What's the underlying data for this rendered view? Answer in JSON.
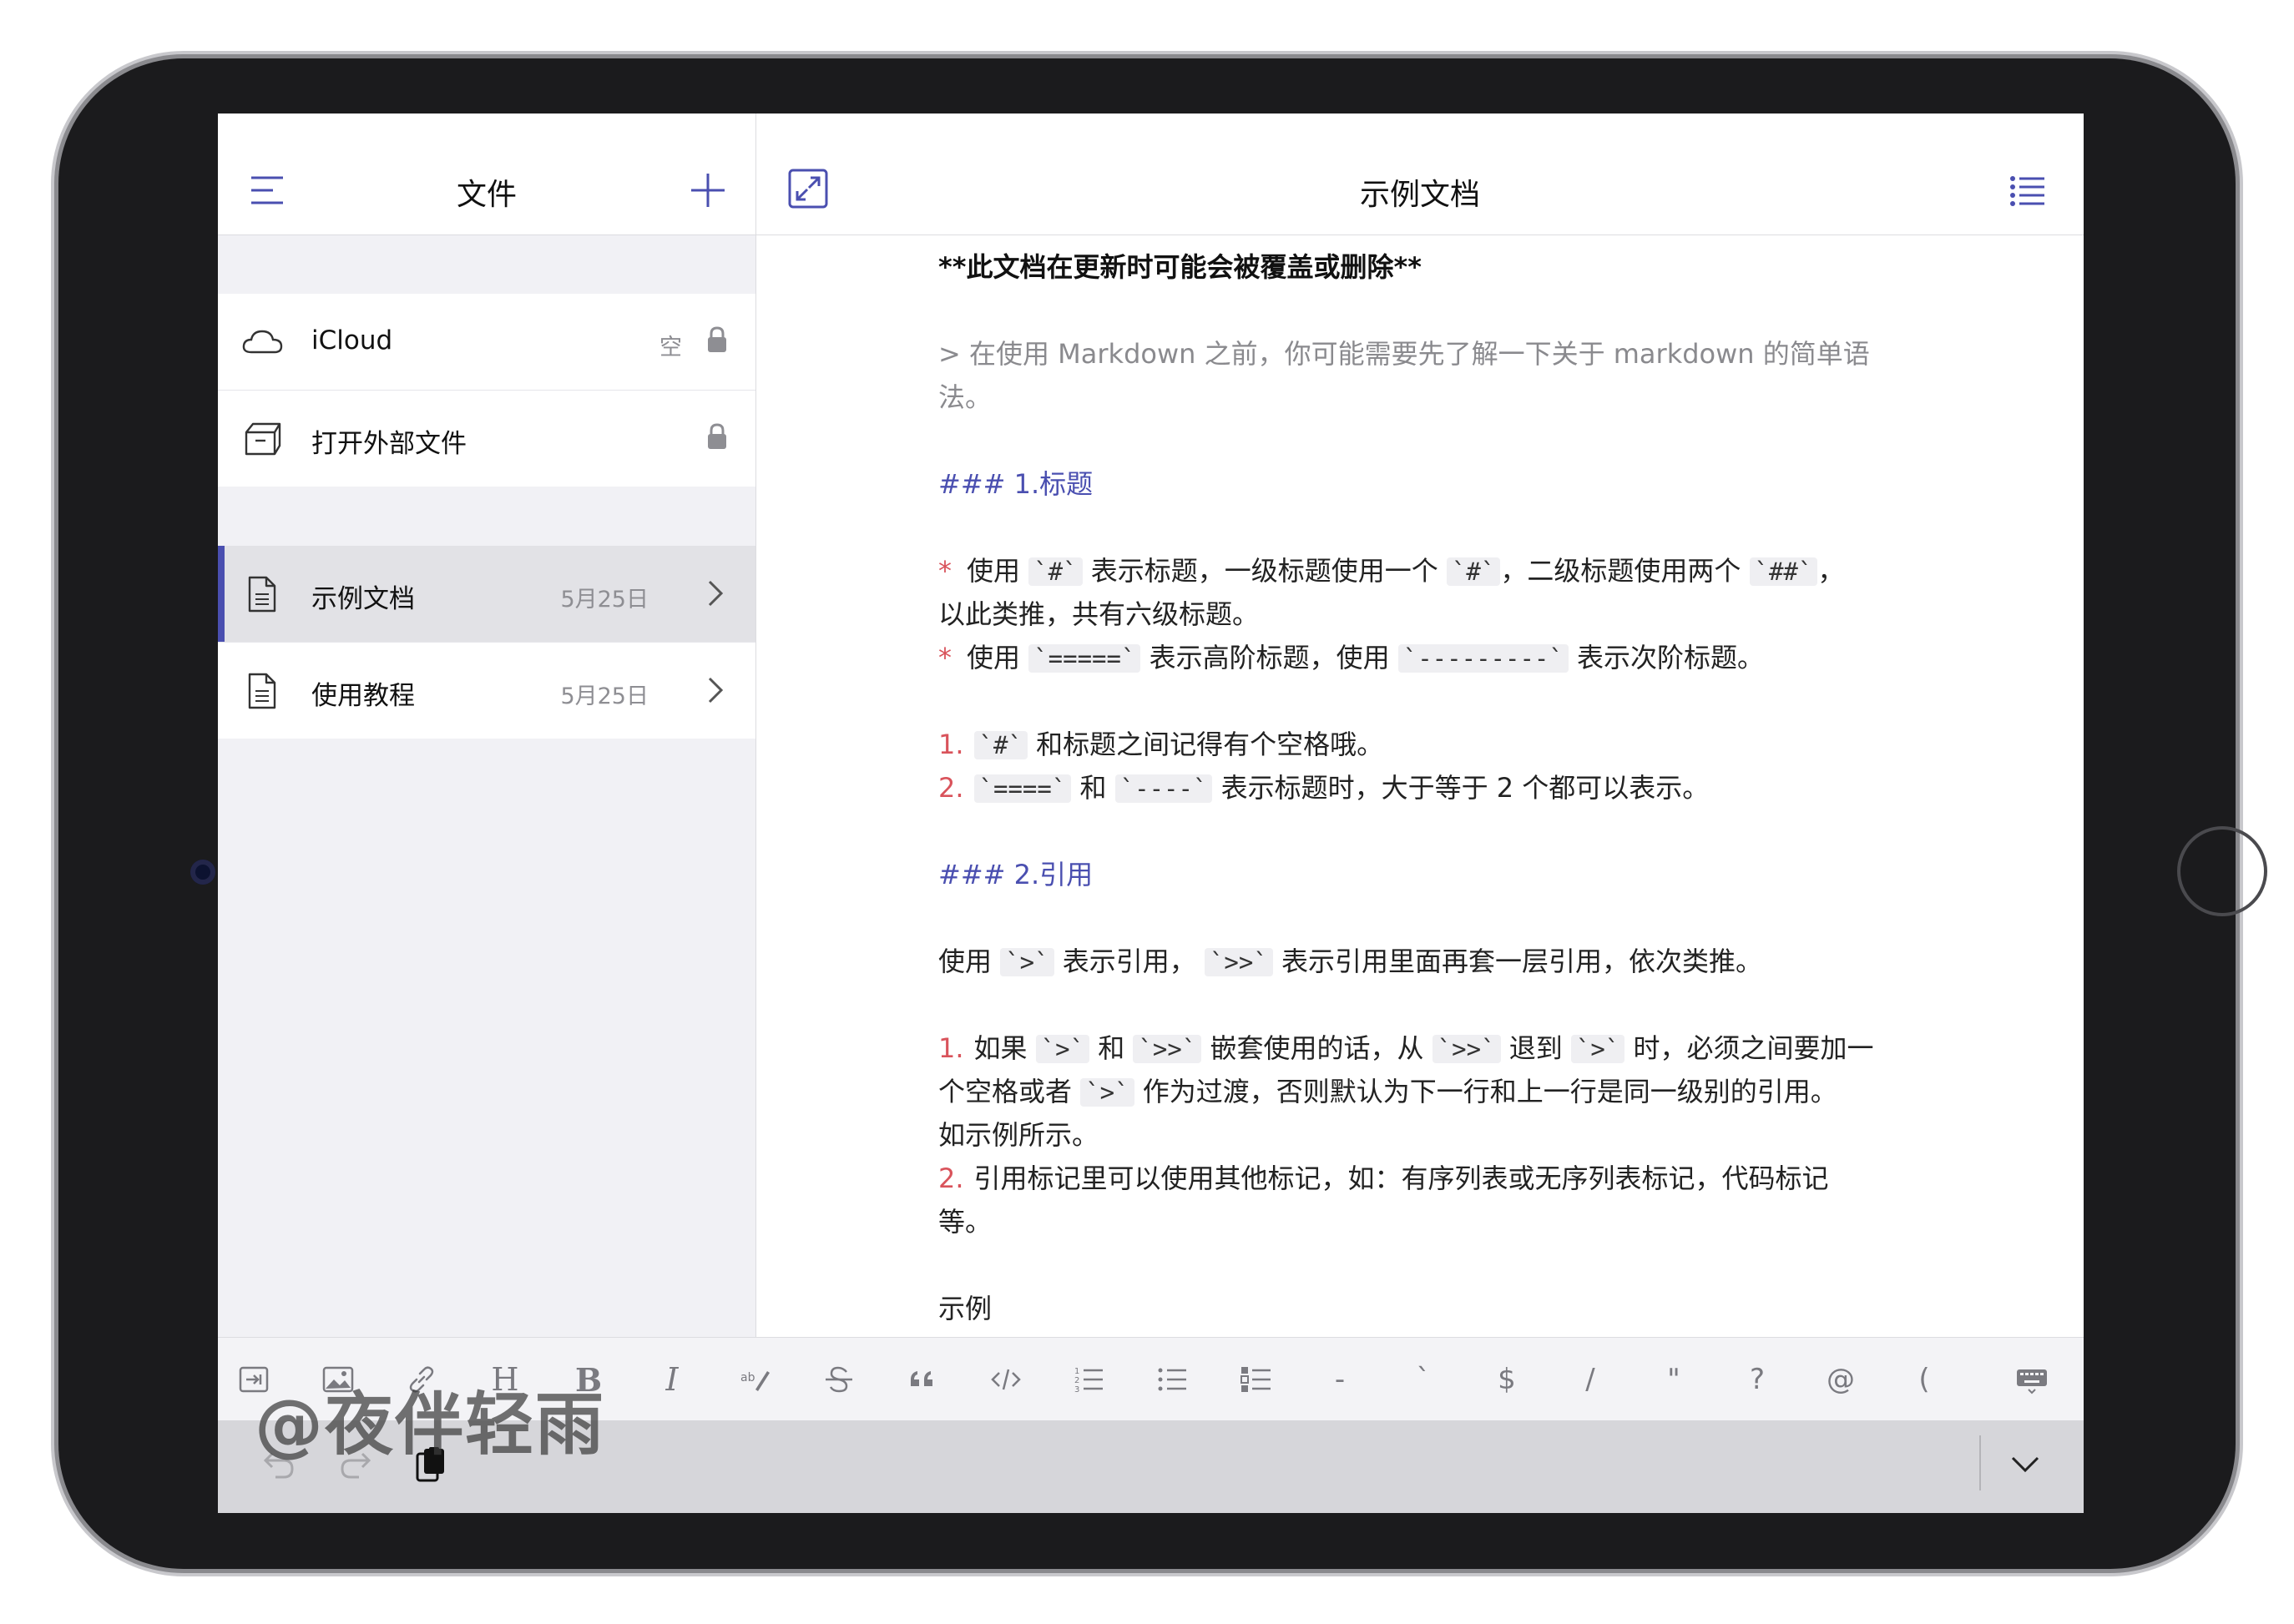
{
  "sidebar": {
    "title": "文件",
    "locations": [
      {
        "label": "iCloud",
        "meta": "空"
      },
      {
        "label": "打开外部文件",
        "meta": ""
      }
    ],
    "documents": [
      {
        "label": "示例文档",
        "date": "5月25日"
      },
      {
        "label": "使用教程",
        "date": "5月25日"
      }
    ]
  },
  "editor": {
    "title": "示例文档",
    "lines": {
      "l1": "**此文档在更新时可能会被覆盖或删除**",
      "l2": "> 在使用 Markdown 之前，你可能需要先了解一下关于 markdown 的简单语",
      "l3": "法。",
      "h1": "### 1.标题",
      "b1_mark": "*",
      "b1_a": "使用 ",
      "b1_c1": "`#`",
      "b1_b": " 表示标题，一级标题使用一个 ",
      "b1_c2": "`#`",
      "b1_c": "，二级标题使用两个 ",
      "b1_c3": "`##`",
      "b1_d": "，",
      "b1_cont": "以此类推，共有六级标题。",
      "b2_mark": "*",
      "b2_a": "使用 ",
      "b2_c1": "`=====`",
      "b2_b": " 表示高阶标题，使用 ",
      "b2_c2": "`---------`",
      "b2_c": " 表示次阶标题。",
      "n1_mark": "1.",
      "n1_c1": "`#`",
      "n1_a": " 和标题之间记得有个空格哦。",
      "n2_mark": "2.",
      "n2_c1": "`====`",
      "n2_a": " 和 ",
      "n2_c2": "`----`",
      "n2_b": " 表示标题时，大于等于 2 个都可以表示。",
      "h2": "### 2.引用",
      "p1_a": "使用 ",
      "p1_c1": "`>`",
      "p1_b": " 表示引用， ",
      "p1_c2": "`>>`",
      "p1_c": " 表示引用里面再套一层引用，依次类推。",
      "q1_mark": "1.",
      "q1_a": "如果 ",
      "q1_c1": "`>`",
      "q1_b": " 和 ",
      "q1_c2": "`>>`",
      "q1_c": " 嵌套使用的话，从 ",
      "q1_c3": "`>>`",
      "q1_d": " 退到 ",
      "q1_c4": "`>`",
      "q1_e": " 时，必须之间要加一",
      "q1_l2a": "个空格或者 ",
      "q1_l2c": "`>`",
      "q1_l2b": " 作为过渡，否则默认为下一行和上一行是同一级别的引用。",
      "q1_l3": "如示例所示。",
      "q2_mark": "2.",
      "q2_a": "引用标记里可以使用其他标记，如：有序列表或无序列表标记，代码标记",
      "q2_l2": "等。",
      "last": "示例"
    }
  },
  "toolbar": {
    "heading": "H",
    "bold": "B",
    "italic": "I",
    "dash": "-",
    "backtick": "`",
    "dollar": "$",
    "slash": "/",
    "quote": "\"",
    "question": "?",
    "at": "@",
    "paren": "("
  },
  "watermark": "@夜伴轻雨",
  "colors": {
    "accent": "#4a4fb0",
    "list_marker": "#d9535b",
    "quote_text": "#8a8a8e",
    "icon_gray": "#7a7a80"
  }
}
